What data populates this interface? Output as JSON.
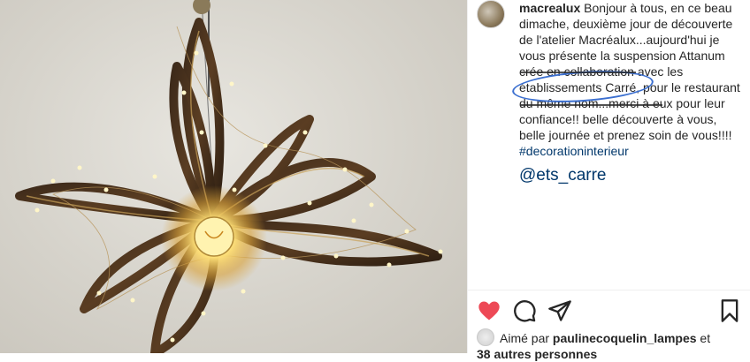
{
  "post": {
    "username": "macrealux",
    "caption_part1": " Bonjour à tous, en ce beau dimache, deuxième jour de découverte de l'atelier Macréalux...aujourd'hui je vous présente la suspension Attanum crée en collaboration avec les ",
    "caption_highlight": "établissements Carré",
    "caption_part2": ", pour le restaurant du même nom...merci à eux pour leur confiance!! belle découverte à vous, belle journée et prenez soin de vous!!!!",
    "hashtag": "#decorationinterieur",
    "mention_annotation": "@ets_carre"
  },
  "actions": {
    "like_icon": "heart-filled-icon",
    "comment_icon": "comment-bubble-icon",
    "share_icon": "paper-plane-icon",
    "save_icon": "bookmark-icon",
    "like_color": "#ed4956"
  },
  "likes": {
    "prefix": "Aimé par ",
    "liker": "paulinecoquelin_lampes",
    "suffix": " et",
    "others": "38 autres personnes"
  },
  "colors": {
    "annotation_blue": "#3b6fd0",
    "link": "#00376b"
  }
}
